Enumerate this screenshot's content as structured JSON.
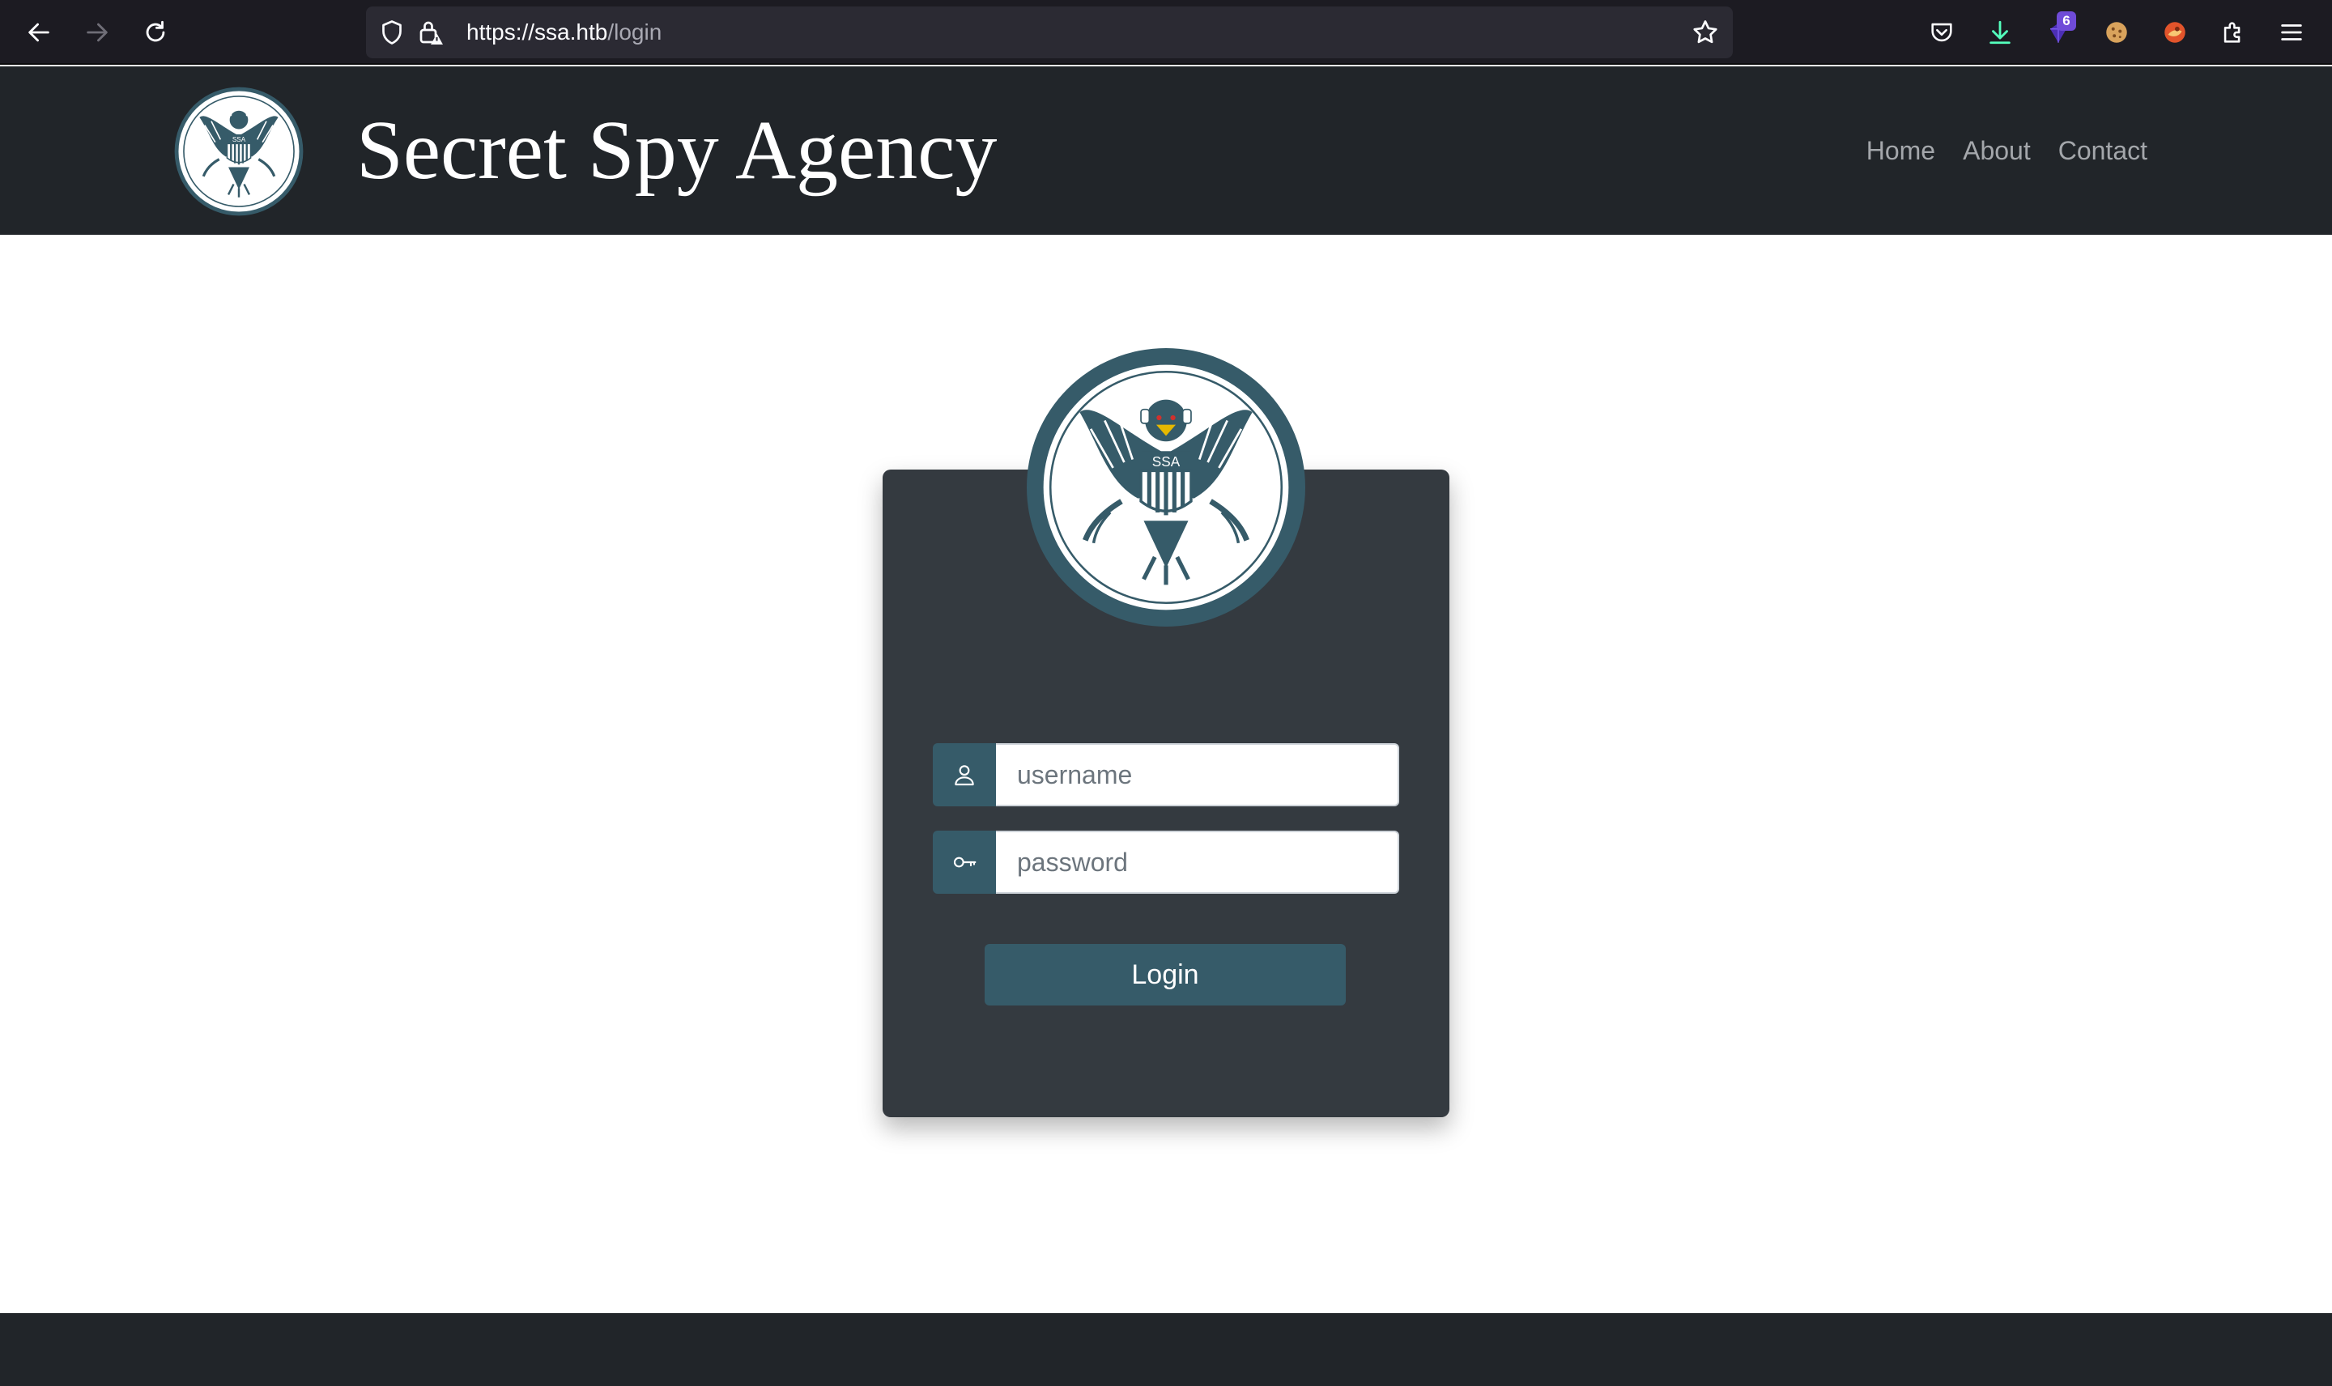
{
  "browser": {
    "url_host": "https://ssa.htb",
    "url_path": "/login",
    "downloads_badge": "6"
  },
  "header": {
    "logo_seal_text": "SSA",
    "title": "Secret Spy Agency",
    "nav": [
      "Home",
      "About",
      "Contact"
    ]
  },
  "login": {
    "seal_text": "SSA",
    "username_placeholder": "username",
    "password_placeholder": "password",
    "button_label": "Login"
  },
  "colors": {
    "header_bg": "#212529",
    "card_bg": "#343a40",
    "accent": "#365b69",
    "page_bg": "#ffffff"
  },
  "icons": {
    "username": "user-icon",
    "password": "key-icon"
  }
}
